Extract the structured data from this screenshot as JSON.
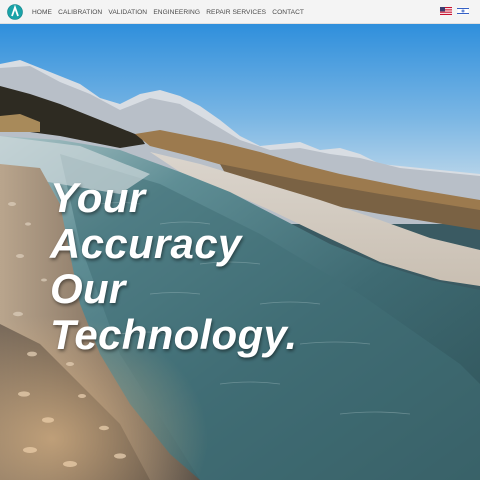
{
  "header": {
    "nav": [
      {
        "label": "HOME"
      },
      {
        "label": "CALIBRATION"
      },
      {
        "label": "VALIDATION"
      },
      {
        "label": "ENGINEERING"
      },
      {
        "label": "REPAIR SERVICES"
      },
      {
        "label": "CONTACT"
      }
    ],
    "logo_icon": "circular-teal-logo",
    "flags": [
      {
        "icon": "us-flag-icon"
      },
      {
        "icon": "israel-flag-icon"
      }
    ],
    "colors": {
      "logo": "#1aa3a8",
      "nav_text": "#4a4a4a",
      "bar": "#f4f4f4"
    }
  },
  "hero": {
    "lines": [
      "Your",
      "Accuracy",
      "Our",
      "Technology."
    ],
    "text_color": "#ffffff"
  }
}
